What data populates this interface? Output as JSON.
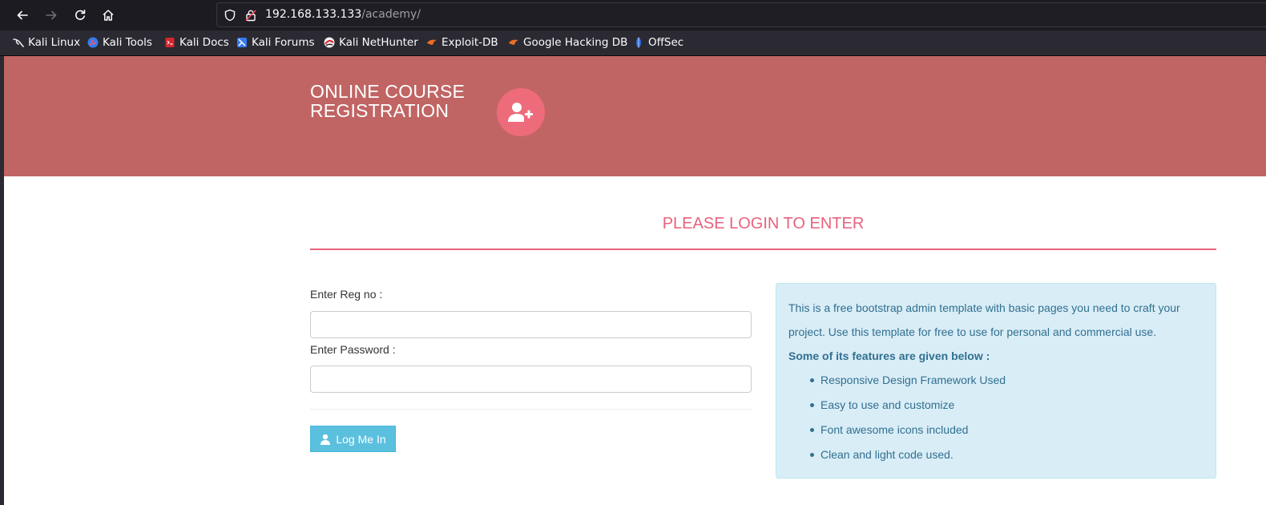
{
  "browser": {
    "url_host": "192.168.133.133",
    "url_path": "/academy/",
    "bookmarks": [
      {
        "label": "Kali Linux",
        "icon": "kali-dragon-icon"
      },
      {
        "label": "Kali Tools",
        "icon": "kali-tools-icon"
      },
      {
        "label": "Kali Docs",
        "icon": "kali-docs-icon"
      },
      {
        "label": "Kali Forums",
        "icon": "kali-forums-icon"
      },
      {
        "label": "Kali NetHunter",
        "icon": "kali-nethunter-icon"
      },
      {
        "label": "Exploit-DB",
        "icon": "exploit-db-icon"
      },
      {
        "label": "Google Hacking DB",
        "icon": "ghdb-icon"
      },
      {
        "label": "OffSec",
        "icon": "offsec-icon"
      }
    ]
  },
  "header": {
    "brand_line1": "ONLINE COURSE",
    "brand_line2": "REGISTRATION",
    "brand_icon": "user-plus-icon",
    "banner_color": "#c06564",
    "icon_bg_color": "#ed6b7b"
  },
  "login": {
    "heading": "PLEASE LOGIN TO ENTER",
    "regno_label": "Enter Reg no :",
    "regno_value": "",
    "password_label": "Enter Password :",
    "password_value": "",
    "button_label": "Log Me In",
    "button_icon": "user-icon",
    "accent_color": "#e8627c"
  },
  "info": {
    "intro": "This is a free bootstrap admin template with basic pages you need to craft your project. Use this template for free to use for personal and commercial use.",
    "features_title": "Some of its features are given below :",
    "features": [
      "Responsive Design Framework Used",
      "Easy to use and customize",
      "Font awesome icons included",
      "Clean and light code used."
    ]
  }
}
